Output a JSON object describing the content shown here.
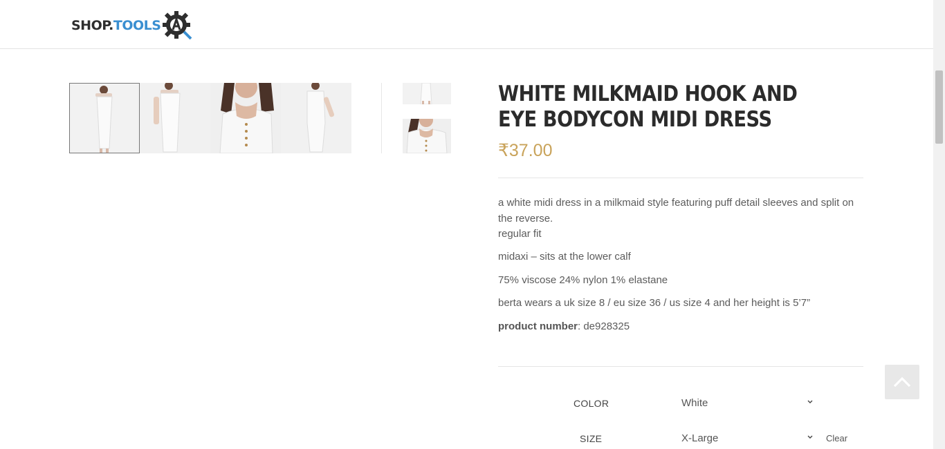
{
  "logo": {
    "part1": "SHOP.",
    "part2": "TOOLS",
    "badge_letter": "A"
  },
  "product": {
    "title": "WHITE MILKMAID HOOK AND EYE BODYCON MIDI DRESS",
    "price": "₹37.00",
    "description": [
      "a white midi dress in a milkmaid style featuring puff detail sleeves and split on the reverse.",
      "regular fit",
      "midaxi – sits at the lower calf",
      "75% viscose 24% nylon 1% elastane",
      "berta wears a uk size 8 / eu size 36 / us size 4 and her height is 5’7”"
    ],
    "product_number_label": "product number",
    "product_number_value": ": de928325"
  },
  "gallery": {
    "thumb_count": 4,
    "active_index": 0
  },
  "variations": {
    "color": {
      "label": "COLOR",
      "value": "White"
    },
    "size": {
      "label": "SIZE",
      "value": "X-Large"
    },
    "clear_label": "Clear"
  },
  "colors": {
    "accent_price": "#c9a35a",
    "logo_blue": "#3a8fd1",
    "logo_dark": "#2e2e2e"
  },
  "icons": {
    "back_to_top": "chevron-up-icon",
    "select_arrow": "chevron-down-icon",
    "logo": "gear-icon"
  }
}
